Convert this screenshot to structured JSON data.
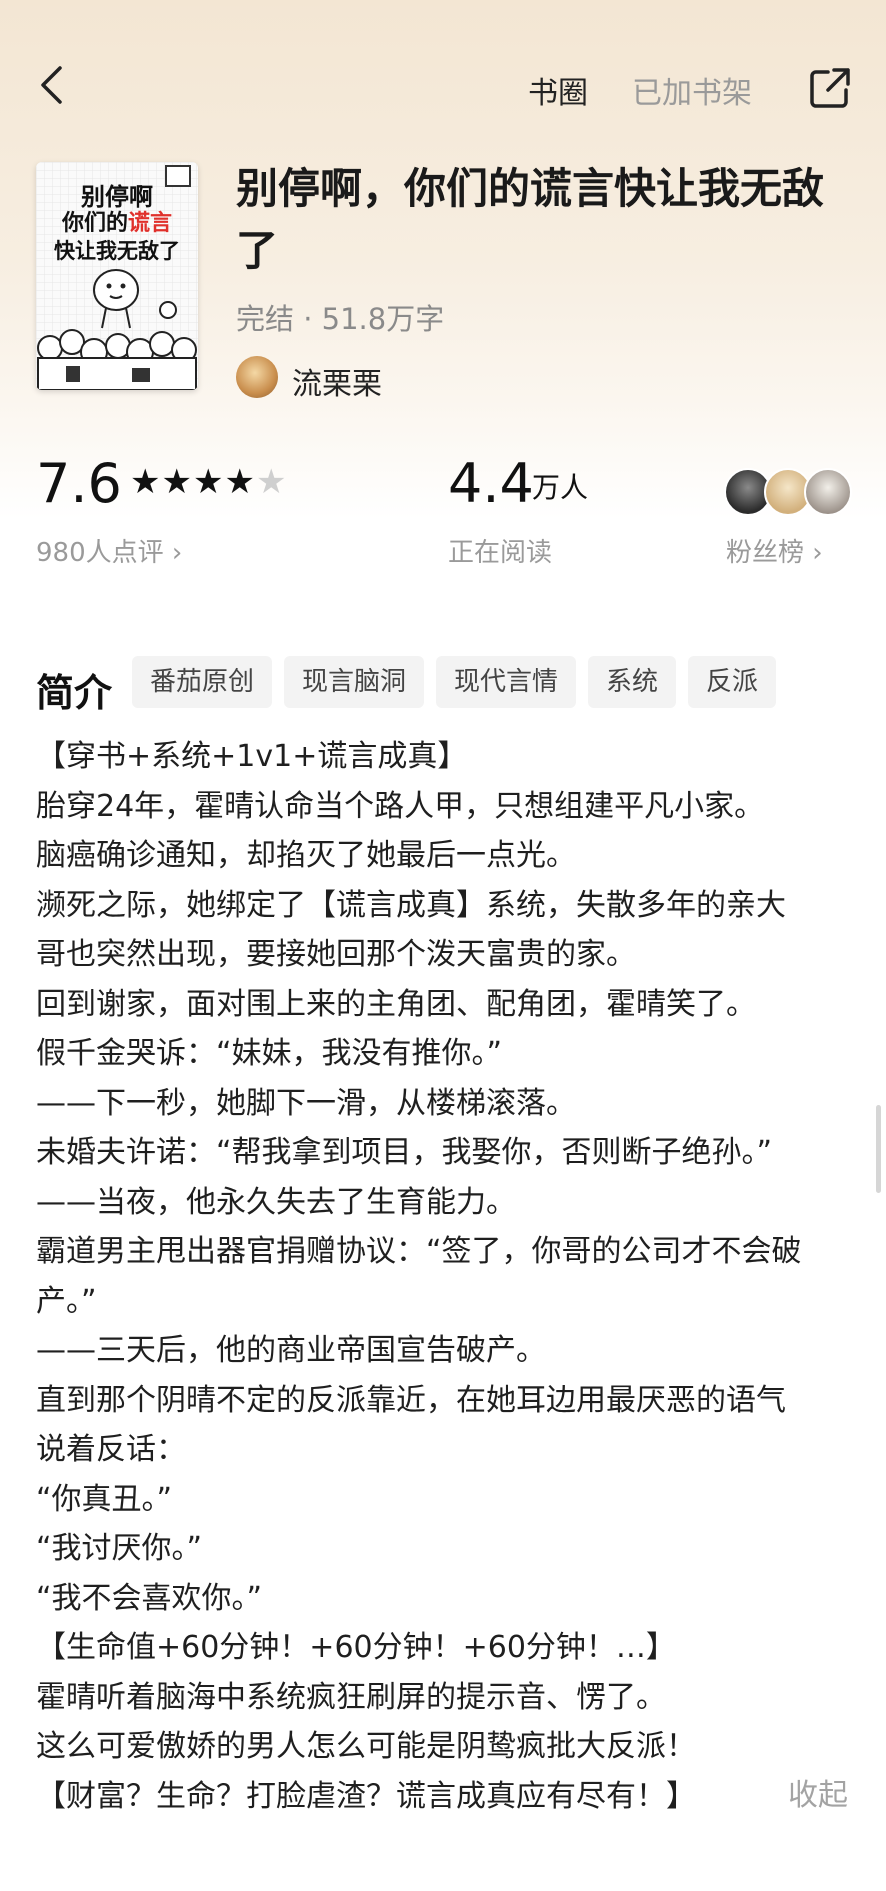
{
  "header": {
    "circle_label": "书圈",
    "bookshelf_label": "已加书架"
  },
  "cover": {
    "line1": "别停啊",
    "line2": "你们的谎言",
    "line3": "快让我无敌了",
    "highlight_color": "#e0302b"
  },
  "book": {
    "title": "别停啊，你们的谎言快让我无敌了",
    "meta": "完结 · 51.8万字",
    "author": "流栗栗"
  },
  "stats": {
    "rating": "7.6",
    "stars_filled": 4,
    "stars_total": 5,
    "reviews": "980人点评 ›",
    "readers": "4.4",
    "readers_unit": "万人",
    "readers_label": "正在阅读",
    "fans_label": "粉丝榜 ›"
  },
  "intro": {
    "heading": "简介",
    "tags": [
      "番茄原创",
      "现言脑洞",
      "现代言情",
      "系统",
      "反派"
    ],
    "lines": [
      "【穿书+系统+1v1+谎言成真】",
      "胎穿24年，霍晴认命当个路人甲，只想组建平凡小家。",
      "脑癌确诊通知，却掐灭了她最后一点光。",
      "濒死之际，她绑定了【谎言成真】系统，失散多年的亲大",
      "哥也突然出现，要接她回那个泼天富贵的家。",
      "回到谢家，面对围上来的主角团、配角团，霍晴笑了。",
      "假千金哭诉：“妹妹，我没有推你。”",
      "——下一秒，她脚下一滑，从楼梯滚落。",
      "未婚夫许诺：“帮我拿到项目，我娶你，否则断子绝孙。”",
      "——当夜，他永久失去了生育能力。",
      "霸道男主甩出器官捐赠协议：“签了，你哥的公司才不会破",
      "产。”",
      "——三天后，他的商业帝国宣告破产。",
      "直到那个阴晴不定的反派靠近，在她耳边用最厌恶的语气",
      "说着反话：",
      "“你真丑。”",
      "“我讨厌你。”",
      "“我不会喜欢你。”",
      "【生命值+60分钟！+60分钟！+60分钟！…】",
      "霍晴听着脑海中系统疯狂刷屏的提示音、愣了。",
      "这么可爱傲娇的男人怎么可能是阴鸷疯批大反派！",
      "【财富？生命？打脸虐渣？谎言成真应有尽有！】"
    ],
    "collapse_label": "收起"
  }
}
